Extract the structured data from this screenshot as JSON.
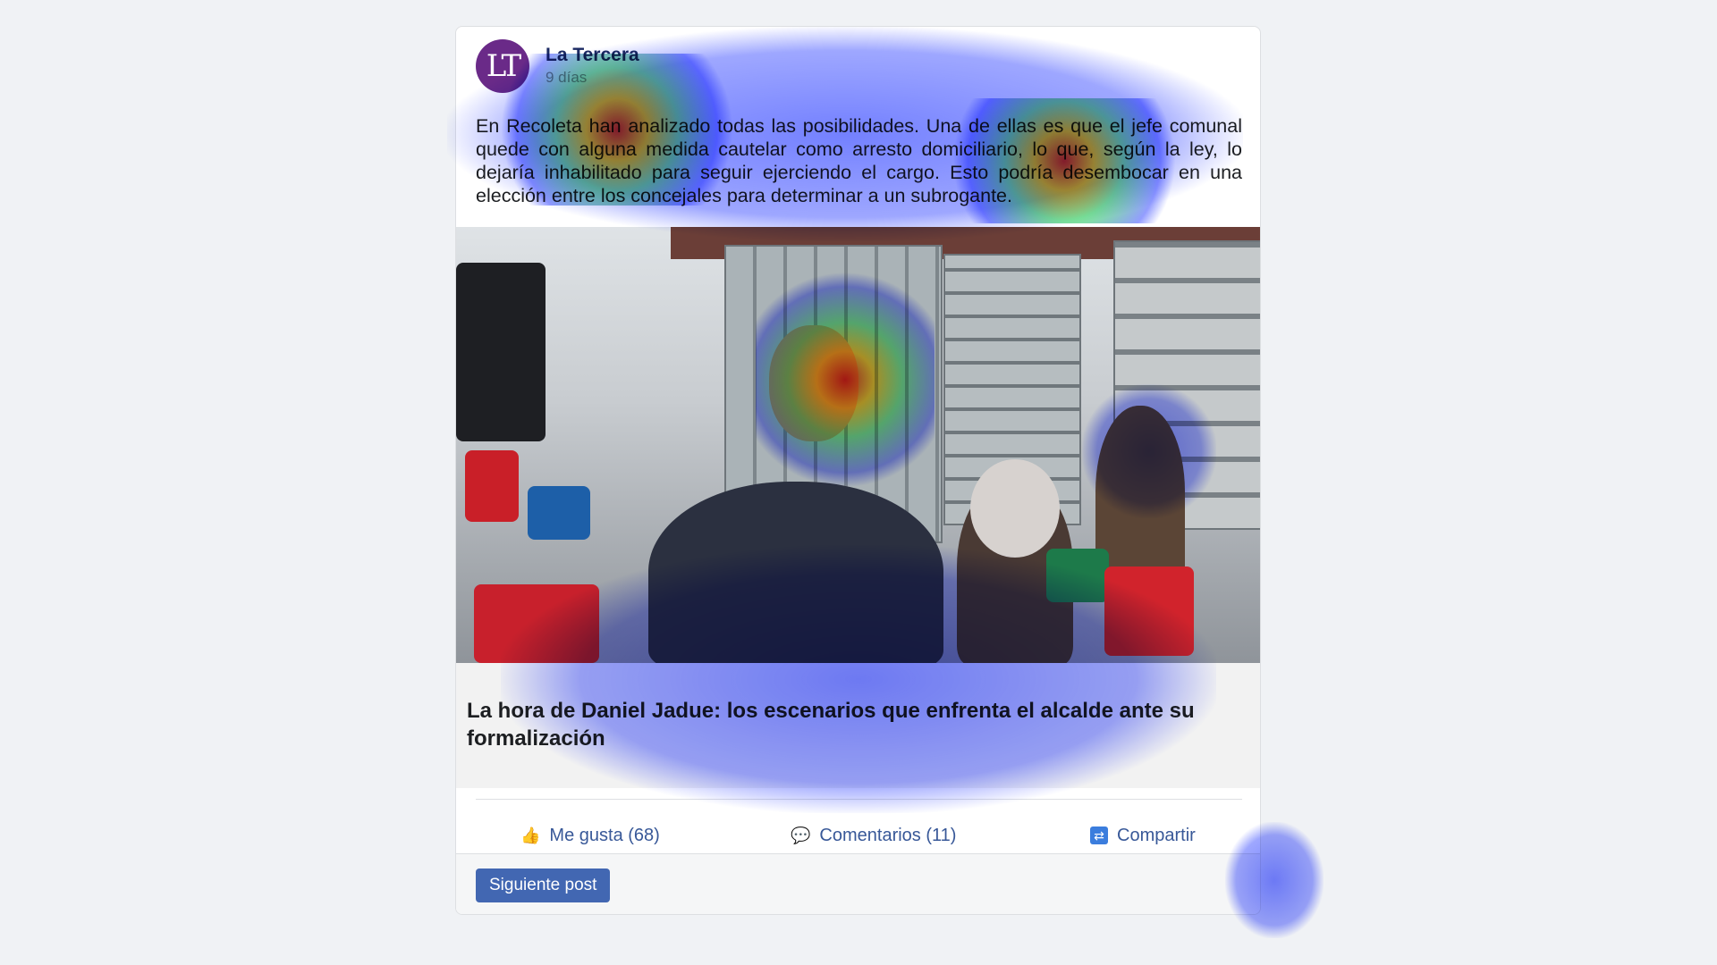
{
  "post": {
    "author": "La Tercera",
    "avatar_text": "LT",
    "timestamp": "9 días",
    "text": "En Recoleta han analizado todas las posibilidades. Una de ellas es que el jefe comunal quede con alguna medida cautelar como arresto domiciliario, lo que, según la ley, lo dejaría inhabilitado para seguir ejerciendo el cargo. Esto podría desembocar en una elección entre los concejales para determinar a un subrogante.",
    "image_icon": "news-photo",
    "link_title": "La hora de Daniel Jadue: los escenarios que enfrenta el alcalde ante su formalización"
  },
  "actions": {
    "like_label": "Me gusta (68)",
    "comment_label": "Comentarios (11)",
    "share_label": "Compartir",
    "like_icon": "thumbs-up-icon",
    "comment_icon": "speech-bubble-icon",
    "share_icon": "share-icon"
  },
  "footer": {
    "next_label": "Siguiente post"
  },
  "colors": {
    "accent": "#385898",
    "button": "#4267b2",
    "background": "#f0f2f5"
  }
}
